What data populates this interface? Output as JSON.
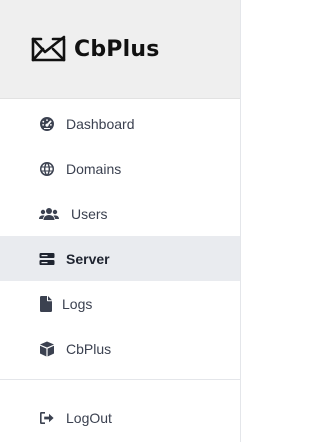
{
  "brand": {
    "name": "CbPlus",
    "icon": "envelope-check-logo"
  },
  "nav": {
    "items": [
      {
        "label": "Dashboard",
        "icon": "gauge-icon",
        "active": false
      },
      {
        "label": "Domains",
        "icon": "globe-icon",
        "active": false
      },
      {
        "label": "Users",
        "icon": "users-icon",
        "active": false
      },
      {
        "label": "Server",
        "icon": "server-icon",
        "active": true
      },
      {
        "label": "Logs",
        "icon": "file-icon",
        "active": false
      },
      {
        "label": "CbPlus",
        "icon": "cube-icon",
        "active": false
      }
    ]
  },
  "footer": {
    "logout_label": "LogOut",
    "logout_icon": "sign-out-icon"
  },
  "colors": {
    "active_bg": "#e9ebef",
    "brand_bg": "#efefef",
    "text": "#3b4150"
  }
}
